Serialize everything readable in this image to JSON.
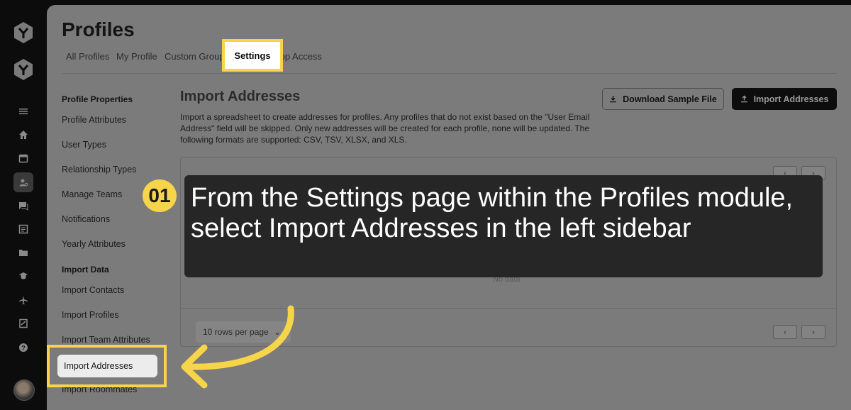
{
  "rail": {
    "icons": [
      "logo-icon",
      "logo-icon",
      "menu-icon",
      "home-icon",
      "calendar-icon",
      "profiles-icon",
      "chat-icon",
      "list-icon",
      "folder-icon",
      "education-icon",
      "plane-icon",
      "document-icon",
      "help-icon"
    ]
  },
  "header": {
    "title": "Profiles",
    "tabs": [
      {
        "label": "All Profiles"
      },
      {
        "label": "My Profile"
      },
      {
        "label": "Custom Groups"
      },
      {
        "label": "Settings"
      },
      {
        "label": "App Access"
      }
    ]
  },
  "sidebar": {
    "profile_properties_heading": "Profile Properties",
    "profile_items": [
      "Profile Attributes",
      "User Types",
      "Relationship Types",
      "Manage Teams",
      "Notifications",
      "Yearly Attributes"
    ],
    "import_data_heading": "Import Data",
    "import_items": [
      "Import Contacts",
      "Import Profiles",
      "Import Team Attributes",
      "Import Addresses",
      "Import Roommates"
    ]
  },
  "content": {
    "title": "Import Addresses",
    "description": "Import a spreadsheet to create addresses for profiles. Any profiles that do not exist based on the \"User Email Address\" field will be skipped. Only new addresses will be created for each profile, none will be updated. The following formats are supported: CSV, TSV, XLSX, and XLS.",
    "download_button": "Download Sample File",
    "import_button": "Import Addresses",
    "table": {
      "empty_text": "No data",
      "rows_per_page": "10 rows per page"
    }
  },
  "callout": {
    "step": "01",
    "text": "From the Settings page within the Profiles module, select Import Addresses in the left sidebar"
  },
  "colors": {
    "highlight": "#f7d54a",
    "callout_bg": "#262626",
    "rail_bg": "#0c0c0c"
  }
}
